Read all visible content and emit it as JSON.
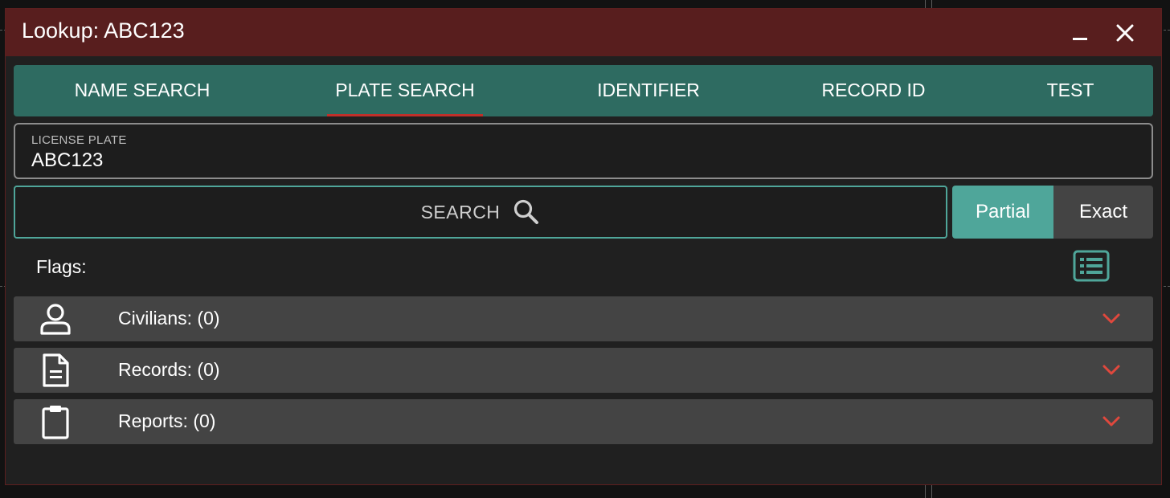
{
  "window": {
    "title": "Lookup: ABC123"
  },
  "tabs": [
    {
      "label": "NAME SEARCH",
      "active": false
    },
    {
      "label": "PLATE SEARCH",
      "active": true
    },
    {
      "label": "IDENTIFIER",
      "active": false
    },
    {
      "label": "RECORD ID",
      "active": false
    },
    {
      "label": "TEST",
      "active": false
    }
  ],
  "plate_field": {
    "label": "LICENSE PLATE",
    "value": "ABC123"
  },
  "search": {
    "label": "SEARCH",
    "icon": "search-icon"
  },
  "match_mode": {
    "options": [
      "Partial",
      "Exact"
    ],
    "selected": "Partial"
  },
  "flags": {
    "label": "Flags:",
    "list_icon": "list-icon"
  },
  "results": [
    {
      "label": "Civilians: (0)",
      "icon": "person-icon"
    },
    {
      "label": "Records: (0)",
      "icon": "document-icon"
    },
    {
      "label": "Reports: (0)",
      "icon": "clipboard-icon"
    }
  ],
  "colors": {
    "titlebar": "#581e1e",
    "tab_bar": "#2e6b61",
    "accent": "#4fa69a",
    "active_tab_underline": "#c0302a",
    "chevron": "#e0483d"
  }
}
